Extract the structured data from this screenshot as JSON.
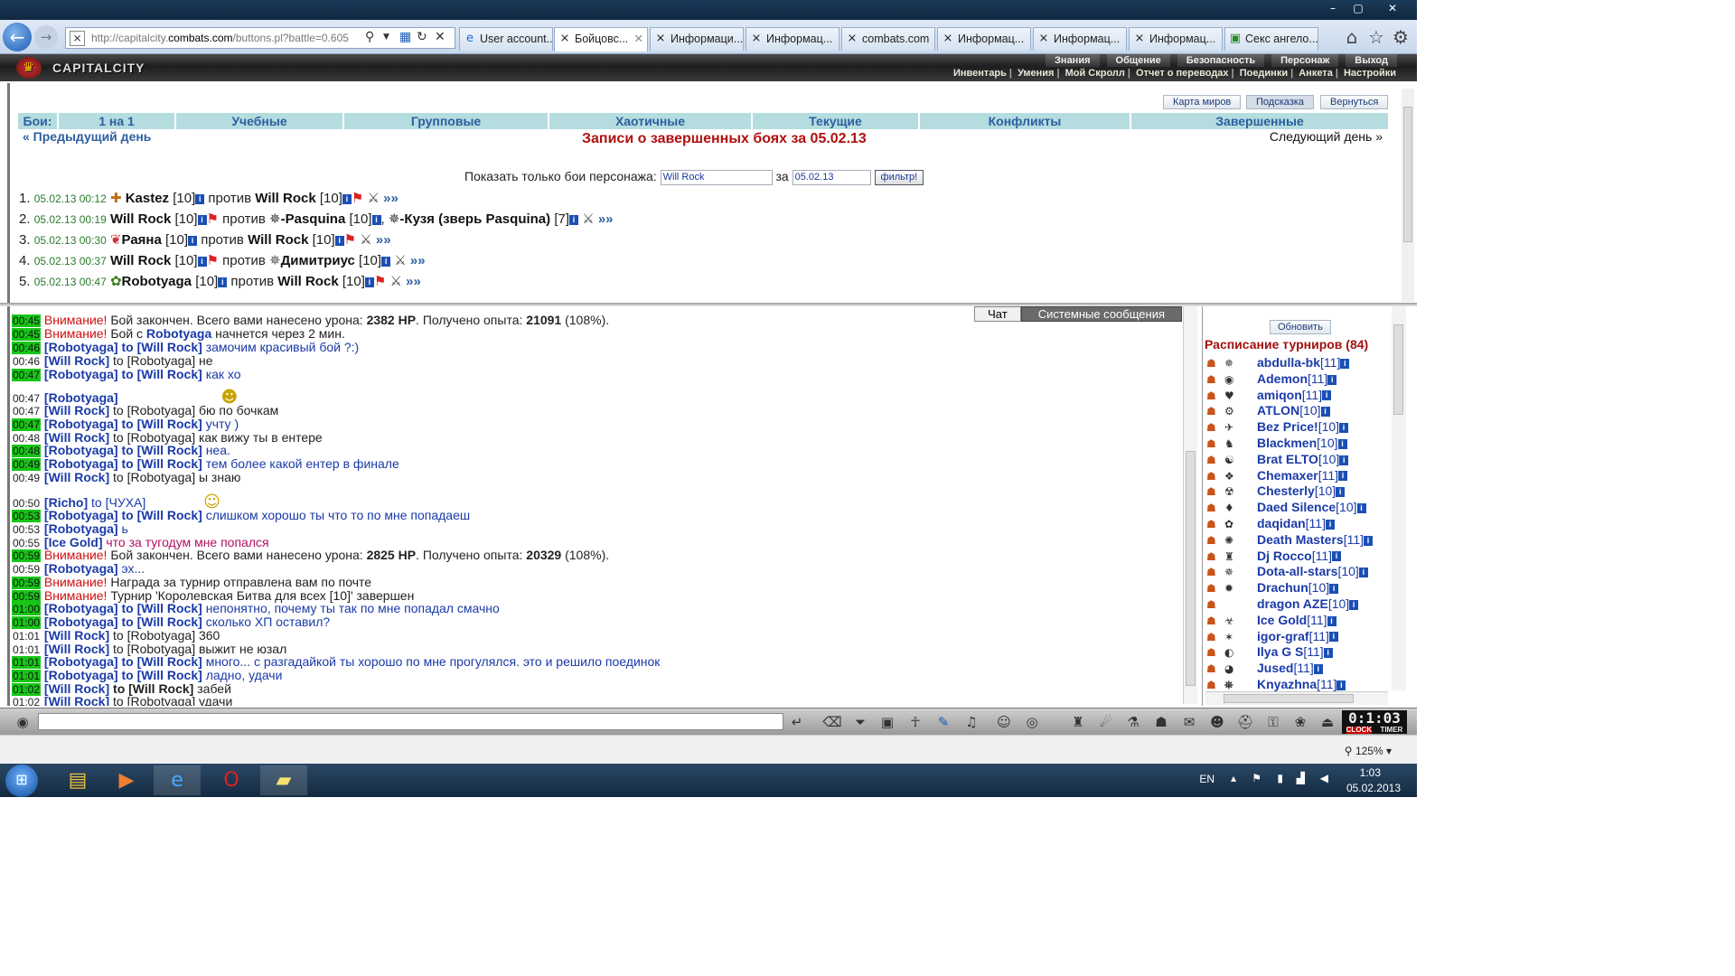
{
  "browser": {
    "url_prefix": "http://capitalcity.",
    "url_domain": "combats.com",
    "url_suffix": "/buttons.pl?battle=0.605",
    "tabs": [
      {
        "label": "User account..."
      },
      {
        "label": "Бойцовс..."
      },
      {
        "label": "Информаци..."
      },
      {
        "label": "Информац..."
      },
      {
        "label": "combats.com"
      },
      {
        "label": "Информац..."
      },
      {
        "label": "Информац..."
      },
      {
        "label": "Информац..."
      },
      {
        "label": "Секс ангело..."
      }
    ],
    "zoom": "125%"
  },
  "game": {
    "logo": "CAPITALCITY",
    "top_menu": [
      "Знания",
      "Общение",
      "Безопасность",
      "Персонаж",
      "Выход"
    ],
    "sub_menu": [
      "Инвентарь",
      "Умения",
      "Мой Скролл",
      "Отчет о переводах",
      "Поединки",
      "Анкета",
      "Настройки"
    ]
  },
  "main": {
    "buttons": {
      "map": "Карта миров",
      "hint": "Подсказка",
      "back": "Вернуться"
    },
    "tabs": [
      "Бои:",
      "1 на 1",
      "Учебные",
      "Групповые",
      "Хаотичные",
      "Текущие",
      "Конфликты",
      "Завершенные"
    ],
    "prev_day": "« Предыдущий день",
    "next_day": "Следующий день »",
    "title": "Записи о завершенных боях за 05.02.13",
    "filter_label": "Показать только бои персонажа:",
    "filter_value": "Will Rock",
    "filter_for": "за",
    "filter_date": "05.02.13",
    "filter_button": "фильтр!",
    "fights": [
      {
        "num": "1.",
        "date": "05.02.13 00:12",
        "p1": "Kastez",
        "p1lvl": "[10]",
        "vs": "против",
        "p2": "Will Rock",
        "p2lvl": "[10]",
        "p3": "",
        "p3lvl": "",
        "more": "»»"
      },
      {
        "num": "2.",
        "date": "05.02.13 00:19",
        "p1": "Will Rock",
        "p1lvl": "[10]",
        "vs": "против",
        "p2": "-Pasquina",
        "p2lvl": "[10]",
        "p3": "-Кузя (зверь Pasquina)",
        "p3lvl": "[7]",
        "more": "»»"
      },
      {
        "num": "3.",
        "date": "05.02.13 00:30",
        "p1": "Раяна",
        "p1lvl": "[10]",
        "vs": "против",
        "p2": "Will Rock",
        "p2lvl": "[10]",
        "p3": "",
        "p3lvl": "",
        "more": "»»"
      },
      {
        "num": "4.",
        "date": "05.02.13 00:37",
        "p1": "Will Rock",
        "p1lvl": "[10]",
        "vs": "против",
        "p2": "Димитриус",
        "p2lvl": "[10]",
        "p3": "",
        "p3lvl": "",
        "more": "»»"
      },
      {
        "num": "5.",
        "date": "05.02.13 00:47",
        "p1": "Robotyaga",
        "p1lvl": "[10]",
        "vs": "против",
        "p2": "Will Rock",
        "p2lvl": "[10]",
        "p3": "",
        "p3lvl": "",
        "more": "»»"
      }
    ]
  },
  "chat": {
    "tab_chat": "Чат",
    "tab_system": "Системные сообщения",
    "lines": [
      {
        "time": "00:45",
        "hl": true,
        "warn": "Внимание!",
        "text": " Бой закончен. Всего вами нанесено урона: ",
        "b1": "2382 HP",
        "text2": ". Получено опыта: ",
        "b2": "21091",
        "text3": " (108%)."
      },
      {
        "time": "00:45",
        "hl": true,
        "warn": "Внимание!",
        "text": " Бой с ",
        "from": "Robotyaga",
        "text2": " начнется через 2 мин."
      },
      {
        "time": "00:46",
        "hl": true,
        "from": "[Robotyaga]",
        "to": "to [Will Rock]",
        "msg": "замочим красивый бой ?:)"
      },
      {
        "time": "00:46",
        "hl": false,
        "from": "[Will Rock]",
        "plain": "to [Robotyaga] не"
      },
      {
        "time": "00:47",
        "hl": true,
        "from": "[Robotyaga]",
        "to": "to [Will Rock]",
        "msg": "как хо"
      },
      {
        "time": "00:47",
        "hl": false,
        "from": "[Robotyaga]",
        "smile": "☻"
      },
      {
        "time": "00:47",
        "hl": false,
        "from": "[Will Rock]",
        "plain": "to [Robotyaga] бю по бочкам"
      },
      {
        "time": "00:47",
        "hl": true,
        "from": "[Robotyaga]",
        "to": "to [Will Rock]",
        "msg": "учту )"
      },
      {
        "time": "00:48",
        "hl": false,
        "from": "[Will Rock]",
        "plain": "to [Robotyaga] как вижу ты в ентере"
      },
      {
        "time": "00:48",
        "hl": true,
        "from": "[Robotyaga]",
        "to": "to [Will Rock]",
        "msg": "неа."
      },
      {
        "time": "00:49",
        "hl": true,
        "from": "[Robotyaga]",
        "to": "to [Will Rock]",
        "msg": "тем более какой ентер в финале"
      },
      {
        "time": "00:49",
        "hl": false,
        "from": "[Will Rock]",
        "plain": "to [Robotyaga] ы знаю"
      },
      {
        "time": "00:50",
        "hl": false,
        "from": "[Richo]",
        "to2": "to [ЧУХА]",
        "smile": "☺"
      },
      {
        "time": "00:53",
        "hl": true,
        "from": "[Robotyaga]",
        "to": "to [Will Rock]",
        "msg": "слишком хорошо ты что то по мне попадаеш"
      },
      {
        "time": "00:53",
        "hl": false,
        "from": "[Robotyaga]",
        "msg": "ь"
      },
      {
        "time": "00:55",
        "hl": false,
        "from": "[Ice Gold]",
        "rmsg": "что за тугодум мне попался"
      },
      {
        "time": "00:59",
        "hl": true,
        "warn": "Внимание!",
        "text": " Бой закончен. Всего вами нанесено урона: ",
        "b1": "2825 HP",
        "text2": ". Получено опыта: ",
        "b2": "20329",
        "text3": " (108%)."
      },
      {
        "time": "00:59",
        "hl": false,
        "from": "[Robotyaga]",
        "msg": "эх..."
      },
      {
        "time": "00:59",
        "hl": true,
        "warn": "Внимание!",
        "text": " Награда за турнир отправлена вам по почте"
      },
      {
        "time": "00:59",
        "hl": true,
        "warn": "Внимание!",
        "text": " Турнир 'Королевская Битва для всех [10]' завершен"
      },
      {
        "time": "01:00",
        "hl": true,
        "from": "[Robotyaga]",
        "to": "to [Will Rock]",
        "msg": "непонятно, почему ты так по мне попадал смачно"
      },
      {
        "time": "01:00",
        "hl": true,
        "from": "[Robotyaga]",
        "to": "to [Will Rock]",
        "msg": "сколько ХП оставил?"
      },
      {
        "time": "01:01",
        "hl": false,
        "from": "[Will Rock]",
        "plain": "to [Robotyaga] 360"
      },
      {
        "time": "01:01",
        "hl": false,
        "from": "[Will Rock]",
        "plain": "to [Robotyaga] выжит не юзал"
      },
      {
        "time": "01:01",
        "hl": true,
        "from": "[Robotyaga]",
        "to": "to [Will Rock]",
        "msg": "много... с разгадайкой ты хорошо по мне прогулялся. это и решило поединок"
      },
      {
        "time": "01:01",
        "hl": true,
        "from": "[Robotyaga]",
        "to": "to [Will Rock]",
        "msg": "ладно, удачи"
      },
      {
        "time": "01:02",
        "hl": true,
        "from": "[Will Rock]",
        "tob": "to [Will Rock]",
        "plain": "забей"
      },
      {
        "time": "01:02",
        "hl": false,
        "from": "[Will Rock]",
        "plain": "to [Robotyaga] удачи"
      }
    ]
  },
  "tournaments": {
    "refresh": "Обновить",
    "title": "Расписание турниров (84)",
    "items": [
      {
        "name": "abdulla-bk",
        "lvl": "[11]"
      },
      {
        "name": "Ademon",
        "lvl": "[11]"
      },
      {
        "name": "amiqon",
        "lvl": "[11]"
      },
      {
        "name": "ATLON",
        "lvl": "[10]"
      },
      {
        "name": "Bez Price!",
        "lvl": "[10]"
      },
      {
        "name": "Blackmen",
        "lvl": "[10]"
      },
      {
        "name": "Brat ELTO",
        "lvl": "[10]"
      },
      {
        "name": "Chemaxer",
        "lvl": "[11]"
      },
      {
        "name": "Chesterly",
        "lvl": "[10]"
      },
      {
        "name": "Daed Silence",
        "lvl": "[10]"
      },
      {
        "name": "daqidan",
        "lvl": "[11]"
      },
      {
        "name": "Death Masters",
        "lvl": "[11]"
      },
      {
        "name": "Dj Rocco",
        "lvl": "[11]"
      },
      {
        "name": "Dota-all-stars",
        "lvl": "[10]"
      },
      {
        "name": "Drachun",
        "lvl": "[10]"
      },
      {
        "name": "dragon AZE",
        "lvl": "[10]"
      },
      {
        "name": "Ice Gold",
        "lvl": "[11]"
      },
      {
        "name": "igor-graf",
        "lvl": "[11]"
      },
      {
        "name": "Ilya G S",
        "lvl": "[11]"
      },
      {
        "name": "Jused",
        "lvl": "[11]"
      },
      {
        "name": "Knyazhna",
        "lvl": "[11]"
      }
    ]
  },
  "gamebar": {
    "clock": "0:1:03",
    "clock_label": "CLOCK",
    "timer_label": "TIMER"
  },
  "taskbar": {
    "lang": "EN",
    "time": "1:03",
    "date": "05.02.2013"
  }
}
